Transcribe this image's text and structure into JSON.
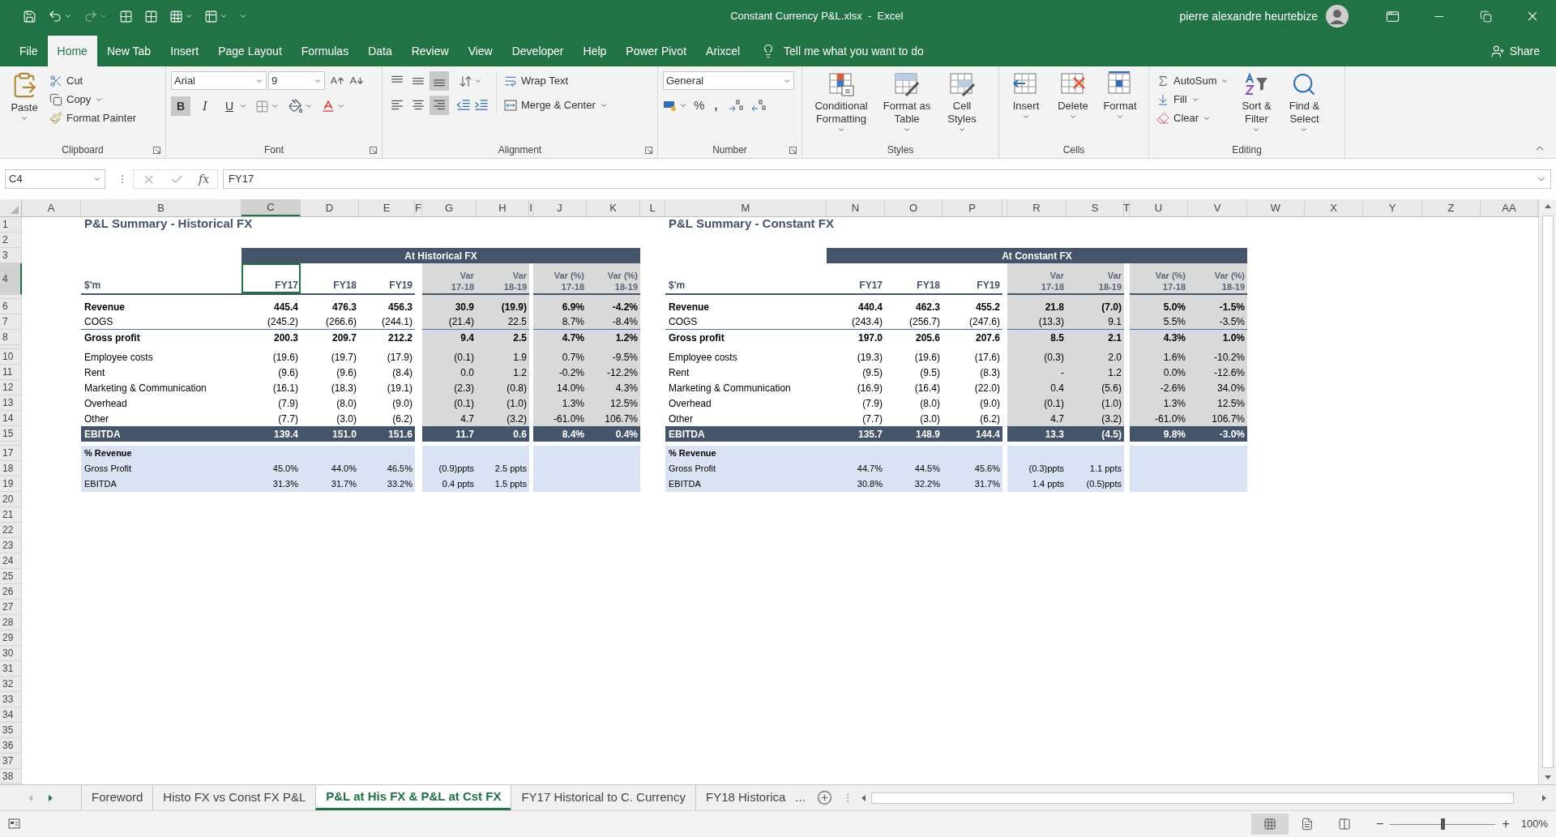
{
  "title_bar": {
    "title": "Constant Currency P&L.xlsx  -  Excel",
    "user": "pierre alexandre heurtebize"
  },
  "menu_tabs": [
    {
      "label": "File",
      "selected": false
    },
    {
      "label": "Home",
      "selected": true
    },
    {
      "label": "New Tab",
      "selected": false
    },
    {
      "label": "Insert",
      "selected": false
    },
    {
      "label": "Page Layout",
      "selected": false
    },
    {
      "label": "Formulas",
      "selected": false
    },
    {
      "label": "Data",
      "selected": false
    },
    {
      "label": "Review",
      "selected": false
    },
    {
      "label": "View",
      "selected": false
    },
    {
      "label": "Developer",
      "selected": false
    },
    {
      "label": "Help",
      "selected": false
    },
    {
      "label": "Power Pivot",
      "selected": false
    },
    {
      "label": "Arixcel",
      "selected": false
    }
  ],
  "tell_me": "Tell me what you want to do",
  "share": "Share",
  "ribbon": {
    "clipboard": {
      "paste": "Paste",
      "cut": "Cut",
      "copy": "Copy",
      "format_painter": "Format Painter",
      "label": "Clipboard"
    },
    "font": {
      "name": "Arial",
      "size": "9",
      "bold": {
        "label": "B",
        "on": true
      },
      "italic": {
        "label": "I",
        "on": false
      },
      "underline": {
        "label": "U",
        "on": false
      },
      "label": "Font"
    },
    "alignment": {
      "buttons": [
        {
          "kind": "top",
          "on": false
        },
        {
          "kind": "middle",
          "on": false
        },
        {
          "kind": "bottom",
          "on": true
        },
        {
          "kind": "left",
          "on": false
        },
        {
          "kind": "center",
          "on": false
        },
        {
          "kind": "right",
          "on": true
        }
      ],
      "wrap_text": "Wrap Text",
      "merge_center": "Merge & Center",
      "label": "Alignment"
    },
    "number": {
      "format": "General",
      "percent": "%",
      "comma": ",",
      "label": "Number"
    },
    "styles": {
      "buttons": [
        "Conditional Formatting",
        "Format as Table",
        "Cell Styles"
      ],
      "label": "Styles"
    },
    "cells": {
      "buttons": [
        "Insert",
        "Delete",
        "Format"
      ],
      "label": "Cells"
    },
    "editing": {
      "autosum": "AutoSum",
      "fill": "Fill",
      "clear": "Clear",
      "sort_filter": "Sort & Filter",
      "find_select": "Find & Select",
      "label": "Editing"
    }
  },
  "formula_bar": {
    "name_box": "C4",
    "fx": "fx",
    "value": "FY17"
  },
  "sheet": {
    "columns": [
      {
        "label": "A",
        "selected": false
      },
      {
        "label": "B",
        "selected": false
      },
      {
        "label": "C",
        "selected": true
      },
      {
        "label": "D",
        "selected": false
      },
      {
        "label": "E",
        "selected": false
      },
      {
        "label": "F",
        "selected": false
      },
      {
        "label": "G",
        "selected": false
      },
      {
        "label": "H",
        "selected": false
      },
      {
        "label": "I",
        "selected": false
      },
      {
        "label": "J",
        "selected": false
      },
      {
        "label": "K",
        "selected": false
      },
      {
        "label": "L",
        "selected": false
      },
      {
        "label": "M",
        "selected": false
      },
      {
        "label": "N",
        "selected": false
      },
      {
        "label": "O",
        "selected": false
      },
      {
        "label": "P",
        "selected": false
      },
      {
        "selected": false
      },
      {
        "label": "R",
        "selected": false
      },
      {
        "label": "S",
        "selected": false
      },
      {
        "label": "T",
        "selected": false
      },
      {
        "label": "U",
        "selected": false
      },
      {
        "label": "V",
        "selected": false
      },
      {
        "label": "W",
        "selected": false
      },
      {
        "label": "X",
        "selected": false
      },
      {
        "label": "Y",
        "selected": false
      },
      {
        "label": "Z",
        "selected": false
      },
      {
        "label": "AA",
        "selected": false
      }
    ],
    "rows": [
      {
        "number": "1",
        "kind": "normal",
        "selected": false
      },
      {
        "number": "2",
        "kind": "normal",
        "selected": false
      },
      {
        "number": "3",
        "kind": "normal",
        "selected": false
      },
      {
        "number": "4",
        "kind": "tall",
        "selected": true
      },
      {
        "kind": "thin",
        "selected": false
      },
      {
        "number": "6",
        "kind": "normal",
        "selected": false
      },
      {
        "number": "7",
        "kind": "normal",
        "selected": false
      },
      {
        "number": "8",
        "kind": "normal",
        "selected": false
      },
      {
        "kind": "thin",
        "selected": false
      },
      {
        "number": "10",
        "kind": "normal",
        "selected": false
      },
      {
        "number": "11",
        "kind": "normal",
        "selected": false
      },
      {
        "number": "12",
        "kind": "normal",
        "selected": false
      },
      {
        "number": "13",
        "kind": "normal",
        "selected": false
      },
      {
        "number": "14",
        "kind": "normal",
        "selected": false
      },
      {
        "number": "15",
        "kind": "normal",
        "selected": false
      },
      {
        "kind": "thin",
        "selected": false
      },
      {
        "number": "17",
        "kind": "normal",
        "selected": false
      },
      {
        "number": "18",
        "kind": "normal",
        "selected": false
      },
      {
        "number": "19",
        "kind": "normal",
        "selected": false
      },
      {
        "number": "20",
        "kind": "normal",
        "selected": false
      },
      {
        "number": "21",
        "kind": "normal",
        "selected": false
      },
      {
        "number": "22",
        "kind": "normal",
        "selected": false
      },
      {
        "number": "23",
        "kind": "normal",
        "selected": false
      },
      {
        "number": "24",
        "kind": "normal",
        "selected": false
      },
      {
        "number": "25",
        "kind": "normal",
        "selected": false
      },
      {
        "number": "26",
        "kind": "normal",
        "selected": false
      },
      {
        "number": "27",
        "kind": "normal",
        "selected": false
      },
      {
        "number": "28",
        "kind": "normal",
        "selected": false
      },
      {
        "number": "29",
        "kind": "normal",
        "selected": false
      },
      {
        "number": "30",
        "kind": "normal",
        "selected": false
      },
      {
        "number": "31",
        "kind": "normal",
        "selected": false
      },
      {
        "number": "32",
        "kind": "normal",
        "selected": false
      },
      {
        "number": "33",
        "kind": "normal",
        "selected": false
      },
      {
        "number": "34",
        "kind": "normal",
        "selected": false
      },
      {
        "number": "35",
        "kind": "normal",
        "selected": false
      },
      {
        "number": "36",
        "kind": "normal",
        "selected": false
      },
      {
        "number": "37",
        "kind": "normal",
        "selected": false
      },
      {
        "number": "38",
        "kind": "normal",
        "selected": false
      }
    ],
    "tables": [
      {
        "title": "P&L Summary - Historical FX",
        "band": "At Historical FX",
        "unit": "$'m",
        "headers": [
          {
            "label": "FY17",
            "selected": true
          },
          {
            "label": "FY18",
            "selected": false
          },
          {
            "label": "FY19",
            "selected": false
          },
          {
            "label": "Var",
            "sub": "17-18",
            "selected": false
          },
          {
            "label": "Var",
            "sub": "18-19",
            "selected": false
          },
          {
            "label": "Var (%)",
            "sub": "17-18",
            "selected": false
          },
          {
            "label": "Var (%)",
            "sub": "18-19",
            "selected": false
          }
        ],
        "lines": [
          {
            "label": "Revenue",
            "kind": "bold",
            "rule_below": false,
            "values": [
              "445.4",
              "476.3",
              "456.3",
              "30.9",
              "(19.9)",
              "6.9%",
              "-4.2%"
            ]
          },
          {
            "label": "COGS",
            "kind": "plain",
            "rule_below": true,
            "values": [
              "(245.2)",
              "(266.6)",
              "(244.1)",
              "(21.4)",
              "22.5",
              "8.7%",
              "-8.4%"
            ]
          },
          {
            "label": "Gross profit",
            "kind": "bold",
            "rule_below": false,
            "values": [
              "200.3",
              "209.7",
              "212.2",
              "9.4",
              "2.5",
              "4.7%",
              "1.2%"
            ]
          },
          {
            "label": "Employee costs",
            "kind": "plain",
            "rule_below": false,
            "values": [
              "(19.6)",
              "(19.7)",
              "(17.9)",
              "(0.1)",
              "1.9",
              "0.7%",
              "-9.5%"
            ]
          },
          {
            "label": "Rent",
            "kind": "plain",
            "rule_below": false,
            "values": [
              "(9.6)",
              "(9.6)",
              "(8.4)",
              "0.0",
              "1.2",
              "-0.2%",
              "-12.2%"
            ]
          },
          {
            "label": "Marketing & Communication",
            "kind": "plain",
            "rule_below": false,
            "values": [
              "(16.1)",
              "(18.3)",
              "(19.1)",
              "(2.3)",
              "(0.8)",
              "14.0%",
              "4.3%"
            ]
          },
          {
            "label": "Overhead",
            "kind": "plain",
            "rule_below": false,
            "values": [
              "(7.9)",
              "(8.0)",
              "(9.0)",
              "(0.1)",
              "(1.0)",
              "1.3%",
              "12.5%"
            ]
          },
          {
            "label": "Other",
            "kind": "plain",
            "rule_below": false,
            "values": [
              "(7.7)",
              "(3.0)",
              "(6.2)",
              "4.7",
              "(3.2)",
              "-61.0%",
              "106.7%"
            ]
          },
          {
            "label": "EBITDA",
            "kind": "total",
            "rule_below": false,
            "values": [
              "139.4",
              "151.0",
              "151.6",
              "11.7",
              "0.6",
              "8.4%",
              "0.4%"
            ]
          }
        ],
        "ratio_title": "% Revenue",
        "ratios": [
          {
            "label": "Gross Profit",
            "values": [
              "45.0%",
              "44.0%",
              "46.5%",
              "(0.9)ppts",
              "2.5 ppts"
            ]
          },
          {
            "label": "EBITDA",
            "values": [
              "31.3%",
              "31.7%",
              "33.2%",
              "0.4 ppts",
              "1.5 ppts"
            ]
          }
        ]
      },
      {
        "title": "P&L Summary - Constant FX",
        "band": "At Constant FX",
        "unit": "$'m",
        "headers": [
          {
            "label": "FY17",
            "selected": false
          },
          {
            "label": "FY18",
            "selected": false
          },
          {
            "label": "FY19",
            "selected": false
          },
          {
            "label": "Var",
            "sub": "17-18",
            "selected": false
          },
          {
            "label": "Var",
            "sub": "18-19",
            "selected": false
          },
          {
            "label": "Var (%)",
            "sub": "17-18",
            "selected": false
          },
          {
            "label": "Var (%)",
            "sub": "18-19",
            "selected": false
          }
        ],
        "lines": [
          {
            "label": "Revenue",
            "kind": "bold",
            "rule_below": false,
            "values": [
              "440.4",
              "462.3",
              "455.2",
              "21.8",
              "(7.0)",
              "5.0%",
              "-1.5%"
            ]
          },
          {
            "label": "COGS",
            "kind": "plain",
            "rule_below": true,
            "values": [
              "(243.4)",
              "(256.7)",
              "(247.6)",
              "(13.3)",
              "9.1",
              "5.5%",
              "-3.5%"
            ]
          },
          {
            "label": "Gross profit",
            "kind": "bold",
            "rule_below": false,
            "values": [
              "197.0",
              "205.6",
              "207.6",
              "8.5",
              "2.1",
              "4.3%",
              "1.0%"
            ]
          },
          {
            "label": "Employee costs",
            "kind": "plain",
            "rule_below": false,
            "values": [
              "(19.3)",
              "(19.6)",
              "(17.6)",
              "(0.3)",
              "2.0",
              "1.6%",
              "-10.2%"
            ]
          },
          {
            "label": "Rent",
            "kind": "plain",
            "rule_below": false,
            "values": [
              "(9.5)",
              "(9.5)",
              "(8.3)",
              "-",
              "1.2",
              "0.0%",
              "-12.6%"
            ]
          },
          {
            "label": "Marketing & Communication",
            "kind": "plain",
            "rule_below": false,
            "values": [
              "(16.9)",
              "(16.4)",
              "(22.0)",
              "0.4",
              "(5.6)",
              "-2.6%",
              "34.0%"
            ]
          },
          {
            "label": "Overhead",
            "kind": "plain",
            "rule_below": false,
            "values": [
              "(7.9)",
              "(8.0)",
              "(9.0)",
              "(0.1)",
              "(1.0)",
              "1.3%",
              "12.5%"
            ]
          },
          {
            "label": "Other",
            "kind": "plain",
            "rule_below": false,
            "values": [
              "(7.7)",
              "(3.0)",
              "(6.2)",
              "4.7",
              "(3.2)",
              "-61.0%",
              "106.7%"
            ]
          },
          {
            "label": "EBITDA",
            "kind": "total",
            "rule_below": false,
            "values": [
              "135.7",
              "148.9",
              "144.4",
              "13.3",
              "(4.5)",
              "9.8%",
              "-3.0%"
            ]
          }
        ],
        "ratio_title": "% Revenue",
        "ratios": [
          {
            "label": "Gross Profit",
            "values": [
              "44.7%",
              "44.5%",
              "45.6%",
              "(0.3)ppts",
              "1.1 ppts"
            ]
          },
          {
            "label": "EBITDA",
            "values": [
              "30.8%",
              "32.2%",
              "31.7%",
              "1.4 ppts",
              "(0.5)ppts"
            ]
          }
        ]
      }
    ]
  },
  "sheet_tabs": {
    "tabs": [
      {
        "label": "Foreword",
        "selected": false
      },
      {
        "label": "Histo FX vs Const FX P&L",
        "selected": false
      },
      {
        "label": "P&L at His FX & P&L at Cst FX",
        "selected": true
      },
      {
        "label": "FY17 Historical to C. Currency",
        "selected": false
      },
      {
        "label": "FY18 Historica",
        "selected": false
      }
    ],
    "more": "..."
  },
  "status_bar": {
    "views": [
      {
        "kind": "normal",
        "selected": true
      },
      {
        "kind": "page_layout",
        "selected": false
      },
      {
        "kind": "page_break",
        "selected": false
      }
    ],
    "zoom_out": "−",
    "zoom_in": "+",
    "level": 0.5,
    "zoom": "100%"
  }
}
